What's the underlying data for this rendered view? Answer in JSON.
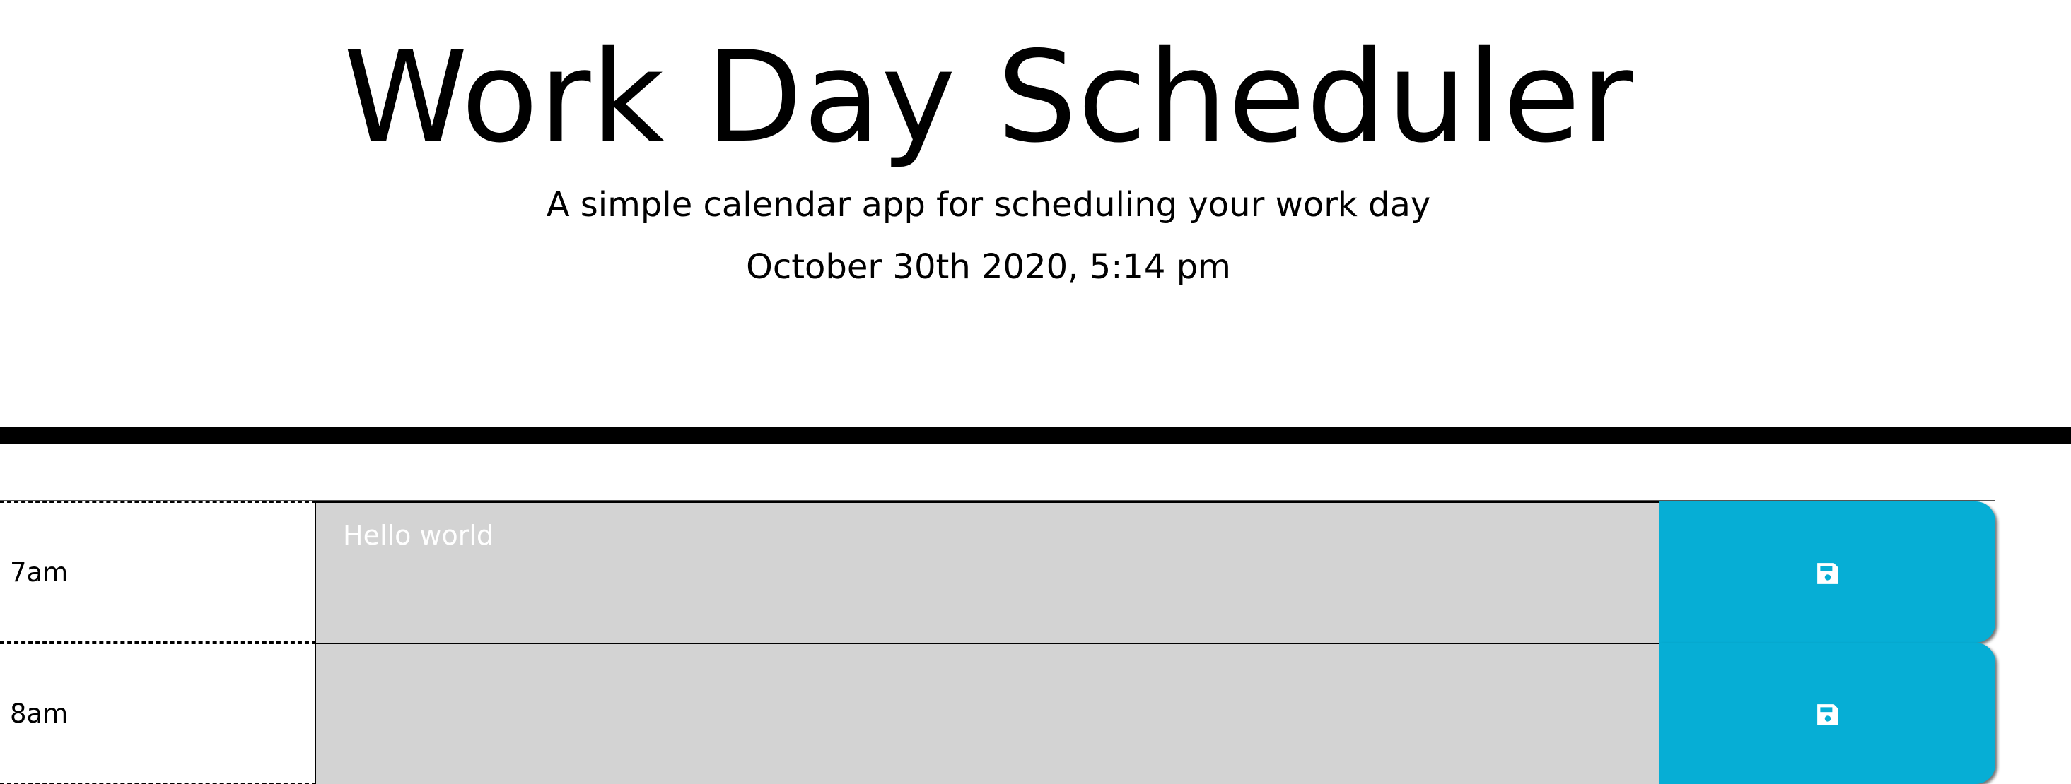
{
  "header": {
    "title": "Work Day Scheduler",
    "subtitle": "A simple calendar app for scheduling your work day",
    "current_day": "October 30th 2020, 5:14 pm"
  },
  "time_blocks": [
    {
      "hour": "7am",
      "text": "Hello world",
      "state": "past"
    },
    {
      "hour": "8am",
      "text": "",
      "state": "past"
    }
  ],
  "colors": {
    "past": "#d3d3d3",
    "save_button": "#06aed5",
    "separator": "#000000"
  },
  "icons": {
    "save": "floppy-disk-icon"
  }
}
